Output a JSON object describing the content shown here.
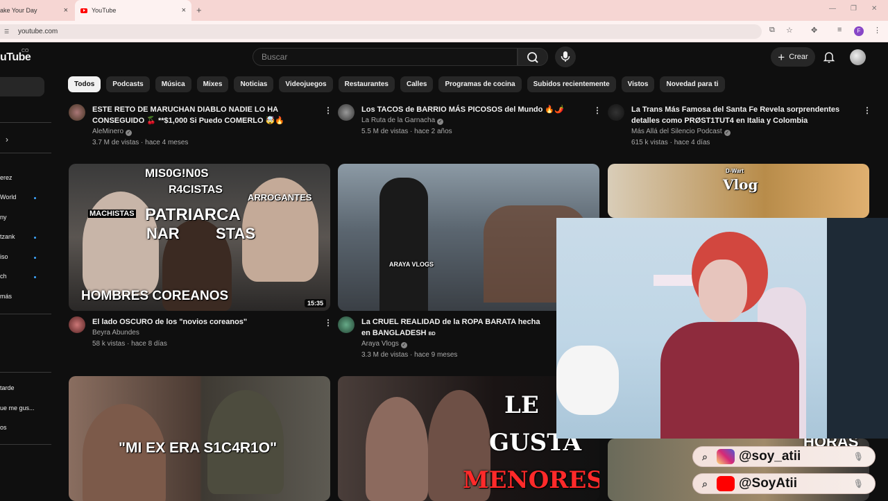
{
  "browser": {
    "tabs": [
      {
        "title": "ake Your Day",
        "active": false
      },
      {
        "title": "YouTube",
        "active": true
      }
    ],
    "new_tab_symbol": "+",
    "close_symbol": "×",
    "url": "youtube.com",
    "profile_initial": "F"
  },
  "header": {
    "logo_text": "uTube",
    "country_code": "CO",
    "search_placeholder": "Buscar",
    "create_label": "Crear"
  },
  "sidebar": {
    "items": [
      {
        "label": "erez",
        "dot": false
      },
      {
        "label": "World",
        "dot": true
      },
      {
        "label": "ny",
        "dot": false
      },
      {
        "label": "tzank",
        "dot": true
      },
      {
        "label": "iso",
        "dot": true
      },
      {
        "label": "ch",
        "dot": true
      },
      {
        "label": "más",
        "dot": false
      },
      {
        "label": "tarde",
        "dot": false
      },
      {
        "label": "ue me gus...",
        "dot": false
      },
      {
        "label": "os",
        "dot": false
      }
    ]
  },
  "chips": [
    "Todos",
    "Podcasts",
    "Música",
    "Mixes",
    "Noticias",
    "Videojuegos",
    "Restaurantes",
    "Calles",
    "Programas de cocina",
    "Subidos recientemente",
    "Vistos",
    "Novedad para ti"
  ],
  "videos": [
    {
      "title": "ESTE RETO DE MARUCHAN DIABLO NADIE LO HA CONSEGUIDO 🍒 **$1,000 Si Puedo COMERLO 🤯🔥",
      "channel": "AleMinero",
      "verified": true,
      "stats": "3.7 M de vistas · hace 4 meses"
    },
    {
      "title": "Los TACOS de BARRIO MÁS PICOSOS del Mundo 🔥🌶️",
      "channel": "La Ruta de la Garnacha",
      "verified": true,
      "stats": "5.5 M de vistas · hace 2 años"
    },
    {
      "title": "La Trans Más Famosa del Santa Fe Revela sorprendentes detalles como PRØST1TUT4 en Italia y Colombia",
      "channel": "Más Allá del Silencio Podcast",
      "verified": true,
      "stats": "615 k vistas · hace 4 días"
    },
    {
      "title": "El lado OSCURO de los \"novios coreanos\"",
      "channel": "Beyra Abundes",
      "verified": false,
      "stats": "58 k vistas · hace 8 días"
    },
    {
      "title": "La CRUEL REALIDAD de la ROPA BARATA hecha en BANGLADESH",
      "title_suffix": "BD",
      "channel": "Araya Vlogs",
      "verified": true,
      "stats": "3.3 M de vistas · hace 9 meses"
    }
  ],
  "thumbnails": {
    "t1": {
      "lines": [
        "MIS0G!N0S",
        "R4CISTAS",
        "ARROGANTES",
        "MACHISTAS",
        "PATRIARCA",
        "NAR",
        "STAS",
        "HOMBRES COREANOS"
      ],
      "duration": "15:35"
    },
    "t2": {
      "shirt_text": "ARAYA VLOGS"
    },
    "t3": {
      "text": "Vlog",
      "small": "D-Wart"
    },
    "t4": {
      "text": "\"MI EX ERA S1C4R1O\""
    },
    "t5": {
      "lines": [
        "LE",
        "GUSTA",
        "MENORES"
      ]
    },
    "t6": {
      "text": "HORAS"
    }
  },
  "overlay": {
    "socials": [
      {
        "handle": "@soy_atii",
        "platform": "instagram-icon",
        "color": "#d6249f"
      },
      {
        "handle": "@SoyAtii",
        "platform": "youtube-icon",
        "color": "#ff0000"
      }
    ]
  }
}
